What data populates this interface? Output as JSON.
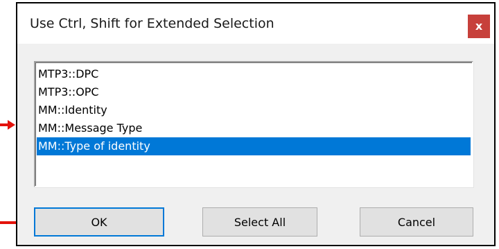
{
  "dialog": {
    "title": "Use Ctrl, Shift for Extended Selection",
    "close_glyph": "x"
  },
  "list": {
    "items": [
      {
        "label": "MTP3::DPC",
        "selected": false
      },
      {
        "label": "MTP3::OPC",
        "selected": false
      },
      {
        "label": "MM::Identity",
        "selected": false
      },
      {
        "label": "MM::Message Type",
        "selected": false
      },
      {
        "label": "MM::Type of identity",
        "selected": true
      }
    ]
  },
  "buttons": {
    "ok": "OK",
    "select_all": "Select All",
    "cancel": "Cancel"
  },
  "colors": {
    "selection": "#0078d7",
    "close_button": "#c7403b",
    "annotation": "#e3120b"
  }
}
